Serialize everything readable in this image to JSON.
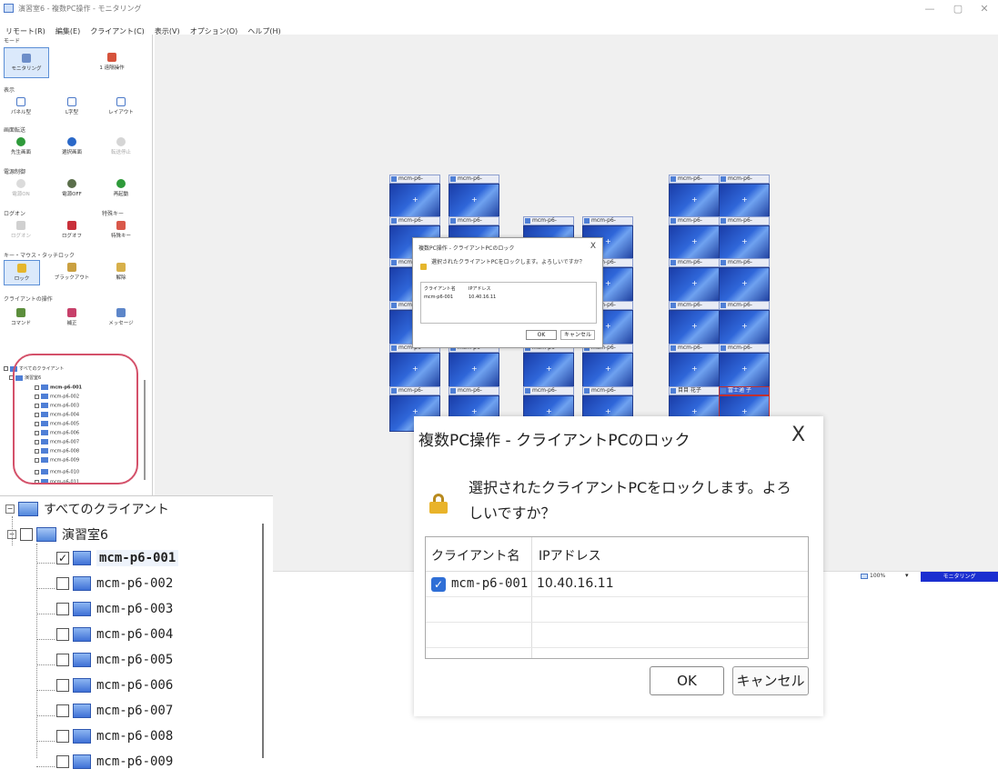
{
  "window": {
    "title": "演習室6 - 複数PC操作 - モニタリング",
    "minimize": "—",
    "maximize": "▢",
    "close": "✕"
  },
  "menu": [
    "リモート(R)",
    "編集(E)",
    "クライアント(C)",
    "表示(V)",
    "オプション(O)",
    "ヘルプ(H)"
  ],
  "panel": {
    "mode_label": "モード",
    "mode_buttons": [
      "モニタリング",
      "1 遠隔操作"
    ],
    "view_label": "表示",
    "view_buttons": [
      "パネル型",
      "L字型",
      "レイアウト"
    ],
    "transfer_label": "画面転送",
    "transfer_buttons": [
      "先生画面",
      "選択画面",
      "転送停止"
    ],
    "power_label": "電源制御",
    "power_buttons": [
      "電源ON",
      "電源OFF",
      "再起動"
    ],
    "logon_label": "ログオン",
    "special_label": "特殊キー",
    "logon_buttons": [
      "ログオン",
      "ログオフ",
      "特殊キー"
    ],
    "lock_label": "キー・マウス・タッチロック",
    "lock_buttons": [
      "ロック",
      "ブラックアウト",
      "解除"
    ],
    "client_label": "クライアントの操作",
    "client_buttons": [
      "コマンド",
      "補正",
      "メッセージ"
    ]
  },
  "small_tree": {
    "root": "すべてのクライアント",
    "group": "演習室6",
    "items": [
      "mcm-p6-001",
      "mcm-p6-002",
      "mcm-p6-003",
      "mcm-p6-004",
      "mcm-p6-005",
      "mcm-p6-006",
      "mcm-p6-007",
      "mcm-p6-008",
      "mcm-p6-009",
      "mcm-p6-010",
      "mcm-p6-011"
    ]
  },
  "tiles": {
    "label": "mcm-p6-",
    "special_1": "目目 花子",
    "special_2": "富士通 子"
  },
  "mini_dialog": {
    "title": "複数PC操作 - クライアントPCのロック",
    "close": "X",
    "message": "選択されたクライアントPCをロックします。よろしいですか？",
    "col1": "クライアント名",
    "col2": "IPアドレス",
    "row_name": "mcm-p6-001",
    "row_ip": "10.40.16.11",
    "ok": "OK",
    "cancel": "キャンセル"
  },
  "statusbar": {
    "zoom": "100%",
    "arrow": "▾",
    "mode": "モニタリング"
  },
  "big_tree": {
    "root": "すべてのクライアント",
    "group": "演習室6",
    "items": [
      {
        "name": "mcm-p6-001",
        "checked": true
      },
      {
        "name": "mcm-p6-002",
        "checked": false
      },
      {
        "name": "mcm-p6-003",
        "checked": false
      },
      {
        "name": "mcm-p6-004",
        "checked": false
      },
      {
        "name": "mcm-p6-005",
        "checked": false
      },
      {
        "name": "mcm-p6-006",
        "checked": false
      },
      {
        "name": "mcm-p6-007",
        "checked": false
      },
      {
        "name": "mcm-p6-008",
        "checked": false
      },
      {
        "name": "mcm-p6-009",
        "checked": false
      }
    ]
  },
  "big_dialog": {
    "title": "複数PC操作 - クライアントPCのロック",
    "close": "X",
    "message": "選択されたクライアントPCをロックします。よろしいですか？",
    "col1": "クライアント名",
    "col2": "IPアドレス",
    "row_name": "mcm-p6-001",
    "row_ip": "10.40.16.11",
    "ok": "OK",
    "cancel": "キャンセル"
  },
  "colors": {
    "accent": "#1b2fd0",
    "highlight": "#d4516a",
    "selection": "#2f6fd6"
  }
}
